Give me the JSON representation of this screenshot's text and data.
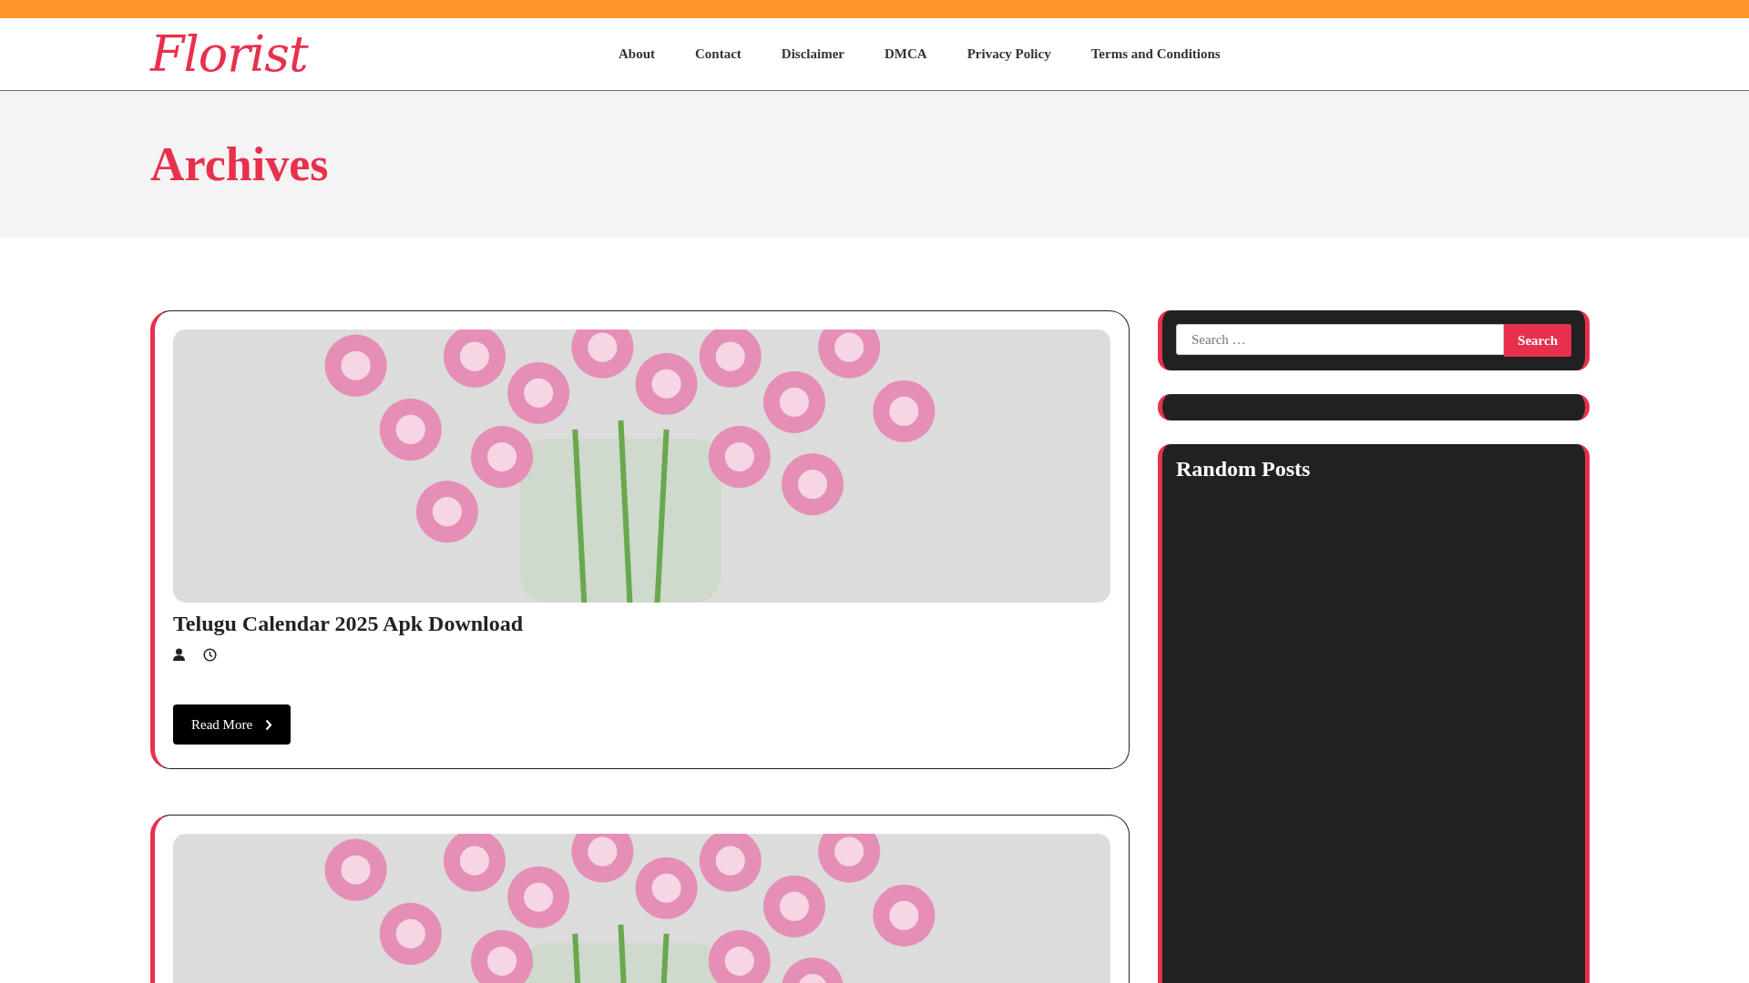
{
  "logo": "Florist",
  "nav": [
    {
      "label": "About"
    },
    {
      "label": "Contact"
    },
    {
      "label": "Disclaimer"
    },
    {
      "label": "DMCA"
    },
    {
      "label": "Privacy Policy"
    },
    {
      "label": "Terms and Conditions"
    }
  ],
  "page_title": "Archives",
  "posts": [
    {
      "kind": "full",
      "title": "Telugu Calendar 2025 Apk Download",
      "button": "Read More"
    },
    {
      "kind": "image_only"
    }
  ],
  "sidebar": [
    {
      "kind": "search",
      "placeholder": "Search …",
      "button": "Search"
    },
    {
      "kind": "empty"
    },
    {
      "kind": "titled",
      "title": "Random Posts"
    }
  ]
}
